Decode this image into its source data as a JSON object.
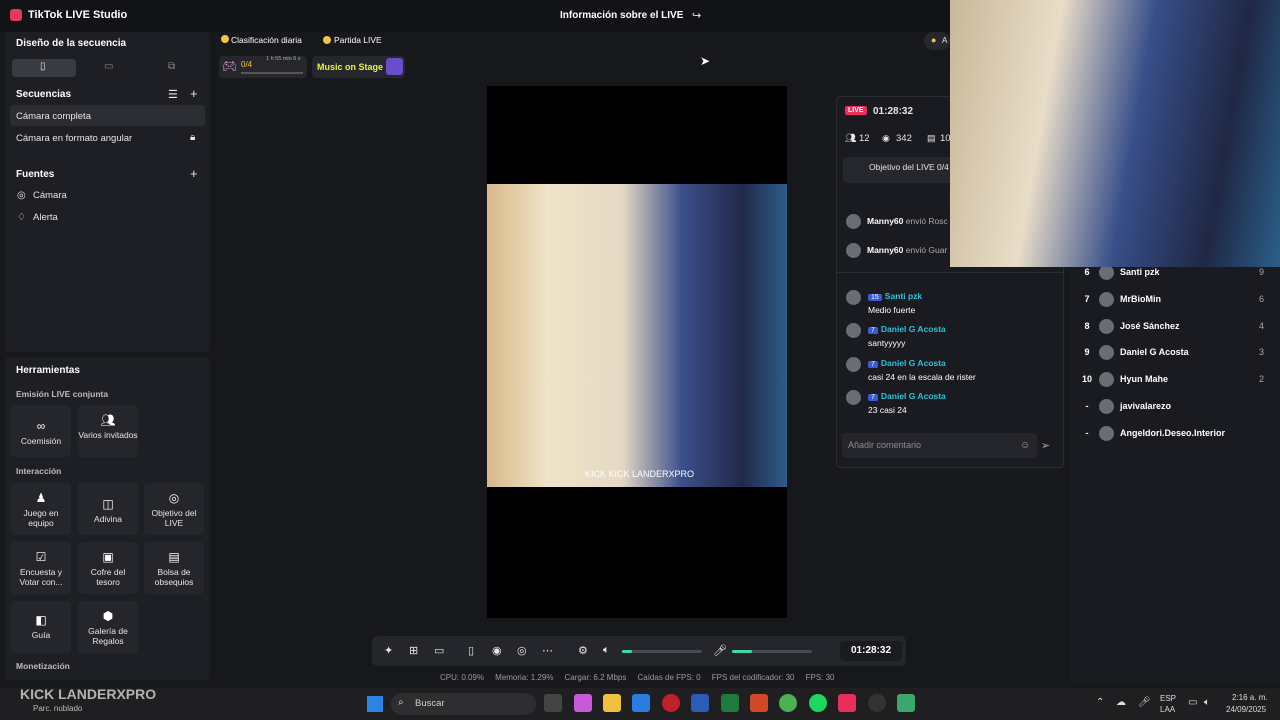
{
  "app": {
    "title": "TikTok LIVE Studio",
    "center_title": "Información sobre el LIVE"
  },
  "left": {
    "design_title": "Diseño de la secuencia",
    "sequences_title": "Secuencias",
    "seq1": "Cámara completa",
    "seq2": "Cámara en formato angular",
    "sources_title": "Fuentes",
    "src1": "Cámara",
    "src2": "Alerta"
  },
  "tools": {
    "title": "Herramientas",
    "joint": "Emisión LIVE conjunta",
    "coem": "Coemisión",
    "guests": "Varios invitados",
    "interaction": "Interacción",
    "team": "Juego en equipo",
    "guess": "Adivina",
    "goal": "Objetivo del LIVE",
    "poll": "Encuesta y Votar con...",
    "chest": "Cofre del tesoro",
    "gifts_bag": "Bolsa de obsequios",
    "guide": "Guía",
    "gallery": "Galería de Regalos",
    "monet": "Monetización"
  },
  "top": {
    "chip1": "Clasificación diaria",
    "chip2": "Partida LIVE",
    "progress": "0/4",
    "time_left": "1 h 55 min 6 s",
    "music": "Music on Stage",
    "right_chip": "A"
  },
  "video": {
    "watermark": "KICK KICK LANDERXPRO"
  },
  "chat": {
    "live": "LIVE",
    "time": "01:28:32",
    "viewers": "12",
    "views": "342",
    "gifts": "10",
    "goal": "Objetivo del LIVE 0/4",
    "gift_rows": [
      {
        "name": "Manny60",
        "text": "envió Rosc"
      },
      {
        "name": "Manny60",
        "text": "envió Guar"
      }
    ],
    "messages": [
      {
        "lvl": "15",
        "name": "Santi pzk",
        "text": "Medio fuerte"
      },
      {
        "lvl": "7",
        "name": "Daniel G Acosta",
        "text": "santyyyyy"
      },
      {
        "lvl": "7",
        "name": "Daniel G Acosta",
        "text": "casi 24 en la escala de rister"
      },
      {
        "lvl": "7",
        "name": "Daniel G Acosta",
        "text": "23 casi 24"
      }
    ],
    "placeholder": "Añadir comentario"
  },
  "ranking": [
    {
      "n": "6",
      "name": "Santi pzk",
      "v": "9"
    },
    {
      "n": "7",
      "name": "MrBioMin",
      "v": "6"
    },
    {
      "n": "8",
      "name": "José Sánchez",
      "v": "4"
    },
    {
      "n": "9",
      "name": "Daniel G Acosta",
      "v": "3"
    },
    {
      "n": "10",
      "name": "Hyun Mahe",
      "v": "2"
    },
    {
      "n": "-",
      "name": "javivalarezo",
      "v": ""
    },
    {
      "n": "-",
      "name": "Angeldori.Deseo.Interior",
      "v": ""
    }
  ],
  "controls": {
    "timer": "01:28:32"
  },
  "stats": {
    "cpu": "CPU:  0.09%",
    "mem": "Memoria:  1.29%",
    "load": "Cargar:  6.2 Mbps",
    "fps_drop": "Caídas de FPS:  0",
    "enc_fps": "FPS del codificador:  30",
    "fps": "FPS:  30"
  },
  "taskbar": {
    "weather": "Parc. nublado",
    "search": "Buscar",
    "lang1": "ESP",
    "lang2": "LAA",
    "time": "2:16 a. m.",
    "date": "24/09/2025",
    "overlay": "KICK LANDERXPRO"
  }
}
